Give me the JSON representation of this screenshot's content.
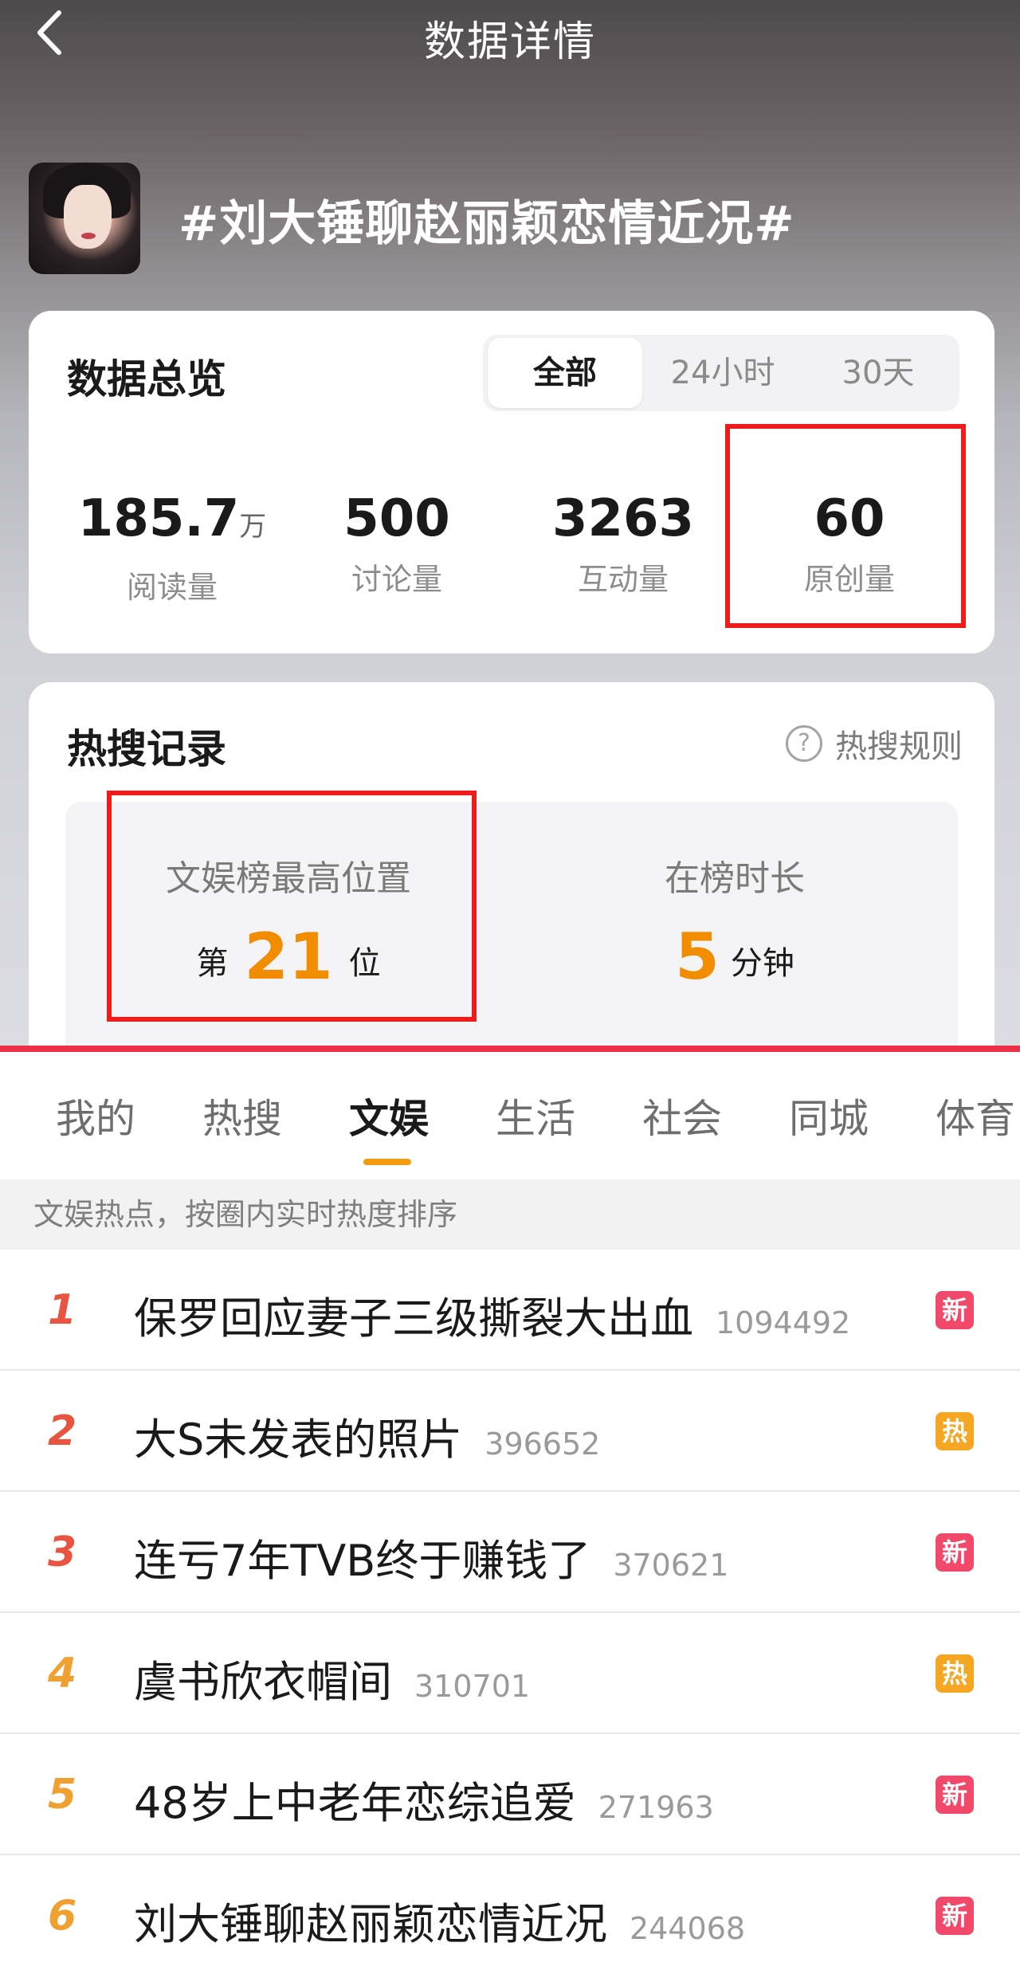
{
  "nav": {
    "title": "数据详情"
  },
  "topic": {
    "title": "#刘大锤聊赵丽颖恋情近况#"
  },
  "overview": {
    "heading": "数据总览",
    "segments": [
      "全部",
      "24小时",
      "30天"
    ],
    "active_segment": "全部",
    "stats": [
      {
        "value": "185.7",
        "unit": "万",
        "label": "阅读量"
      },
      {
        "value": "500",
        "unit": "",
        "label": "讨论量"
      },
      {
        "value": "3263",
        "unit": "",
        "label": "互动量"
      },
      {
        "value": "60",
        "unit": "",
        "label": "原创量"
      }
    ]
  },
  "hot_record": {
    "heading": "热搜记录",
    "rules_label": "热搜规则",
    "help_icon": "question-circle-icon",
    "best_position": {
      "label": "文娱榜最高位置",
      "prefix": "第",
      "value": "21",
      "suffix": "位"
    },
    "duration": {
      "label": "在榜时长",
      "value": "5",
      "suffix": "分钟"
    }
  },
  "tabs": [
    "我的",
    "热搜",
    "文娱",
    "生活",
    "社会",
    "同城",
    "体育"
  ],
  "active_tab": "文娱",
  "subheader": "文娱热点，按圈内实时热度排序",
  "colors": {
    "accent": "#f39c12",
    "highlight_box": "#ee1c1c",
    "new_badge": "#f2486a",
    "hot_badge": "#f5a623"
  },
  "trending": [
    {
      "rank": "1",
      "title": "保罗回应妻子三级撕裂大出血",
      "count": "1094492",
      "badge": "新",
      "badge_type": "new"
    },
    {
      "rank": "2",
      "title": "大S未发表的照片",
      "count": "396652",
      "badge": "热",
      "badge_type": "hot"
    },
    {
      "rank": "3",
      "title": "连亏7年TVB终于赚钱了",
      "count": "370621",
      "badge": "新",
      "badge_type": "new"
    },
    {
      "rank": "4",
      "title": "虞书欣衣帽间",
      "count": "310701",
      "badge": "热",
      "badge_type": "hot"
    },
    {
      "rank": "5",
      "title": "48岁上中老年恋综追爱",
      "count": "271963",
      "badge": "新",
      "badge_type": "new"
    },
    {
      "rank": "6",
      "title": "刘大锤聊赵丽颖恋情近况",
      "count": "244068",
      "badge": "新",
      "badge_type": "new"
    }
  ]
}
